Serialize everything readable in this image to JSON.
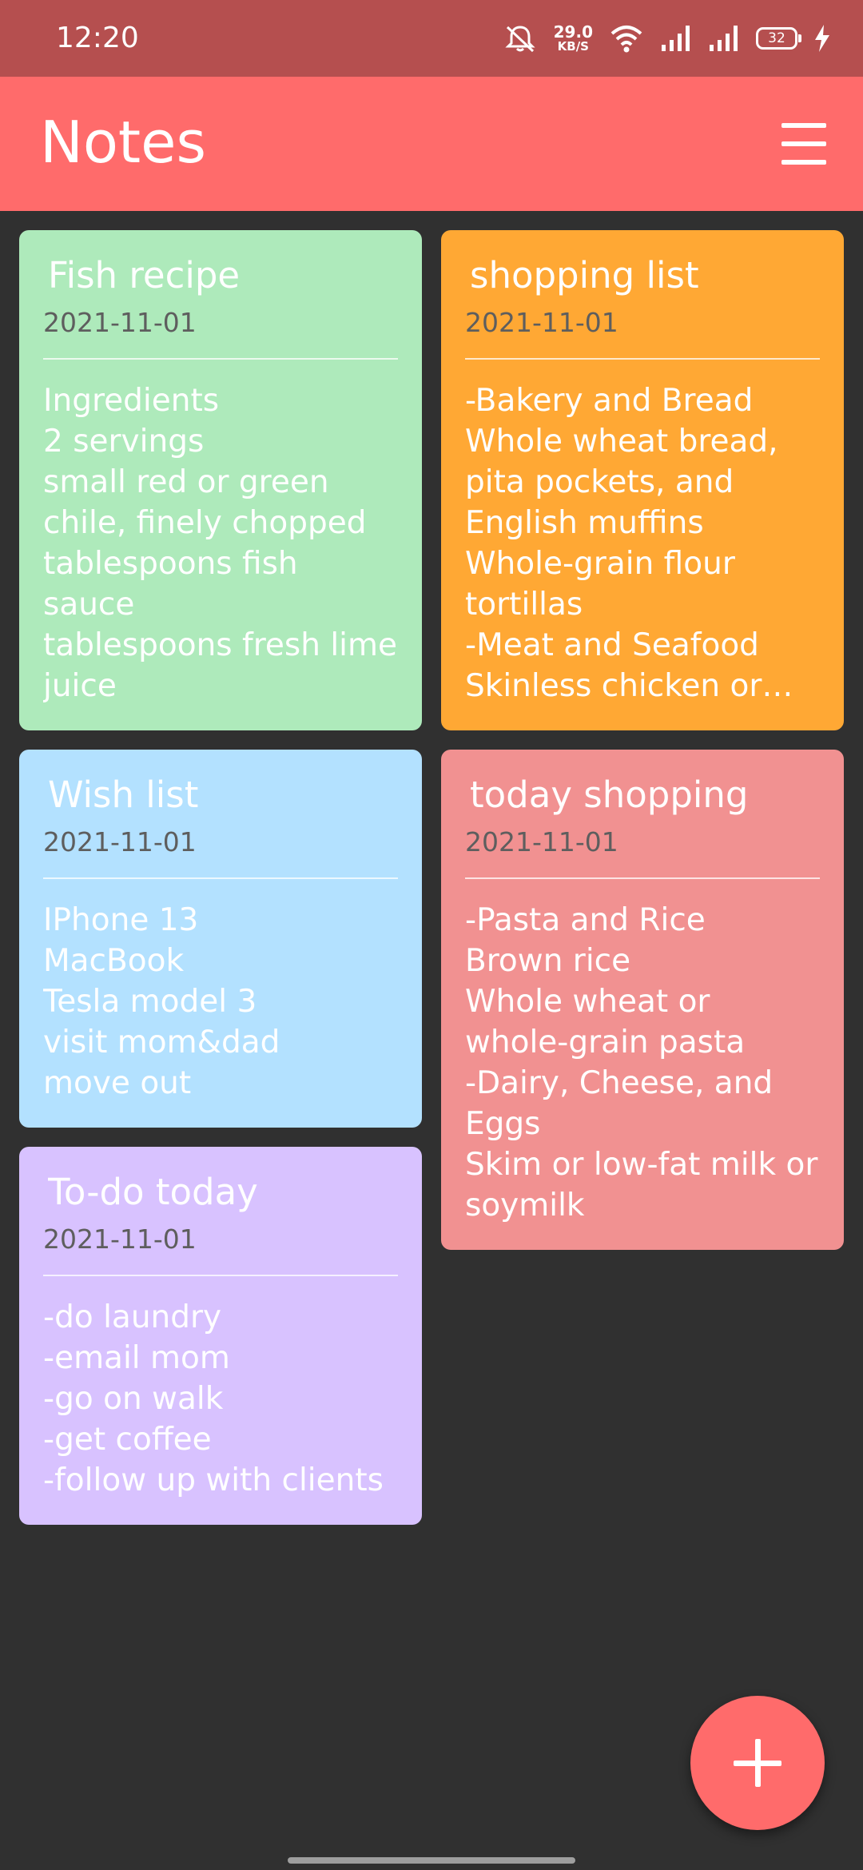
{
  "status_bar": {
    "time": "12:20",
    "net_speed_value": "29.0",
    "net_speed_unit": "KB/S",
    "battery_level": "32",
    "icons": [
      "mute-icon",
      "wifi-icon",
      "signal-icon",
      "signal-icon",
      "battery-icon",
      "charging-icon"
    ]
  },
  "app_bar": {
    "title": "Notes",
    "menu_icon": "hamburger-menu-icon",
    "color": "#ff6b6b"
  },
  "notes": [
    {
      "title": "Fish recipe",
      "date": "2021-11-01",
      "body": "Ingredients\n2 servings\nsmall red or green chile, finely chopped\ntablespoons fish sauce\ntablespoons fresh lime juice",
      "color": "#aeeabb"
    },
    {
      "title": "shopping list",
      "date": "2021-11-01",
      "body": "-Bakery and Bread\nWhole wheat bread, pita pockets, and English muffins\nWhole-grain flour tortillas\n-Meat and Seafood\nSkinless chicken or turkey",
      "color": "#ffa834"
    },
    {
      "title": "Wish list",
      "date": "2021-11-01",
      "body": "IPhone 13\nMacBook\nTesla model 3\nvisit mom&dad\nmove out",
      "color": "#b3e1ff"
    },
    {
      "title": "today shopping",
      "date": "2021-11-01",
      "body": "-Pasta and Rice\nBrown rice\nWhole wheat or whole-grain pasta\n-Dairy, Cheese, and Eggs\nSkim or low-fat milk or soymilk",
      "color": "#f19191"
    },
    {
      "title": "To-do today",
      "date": "2021-11-01",
      "body": "-do laundry\n-email mom\n-go on walk\n-get coffee\n-follow up with clients",
      "color": "#d8c2ff"
    }
  ],
  "fab": {
    "icon": "plus-icon"
  }
}
